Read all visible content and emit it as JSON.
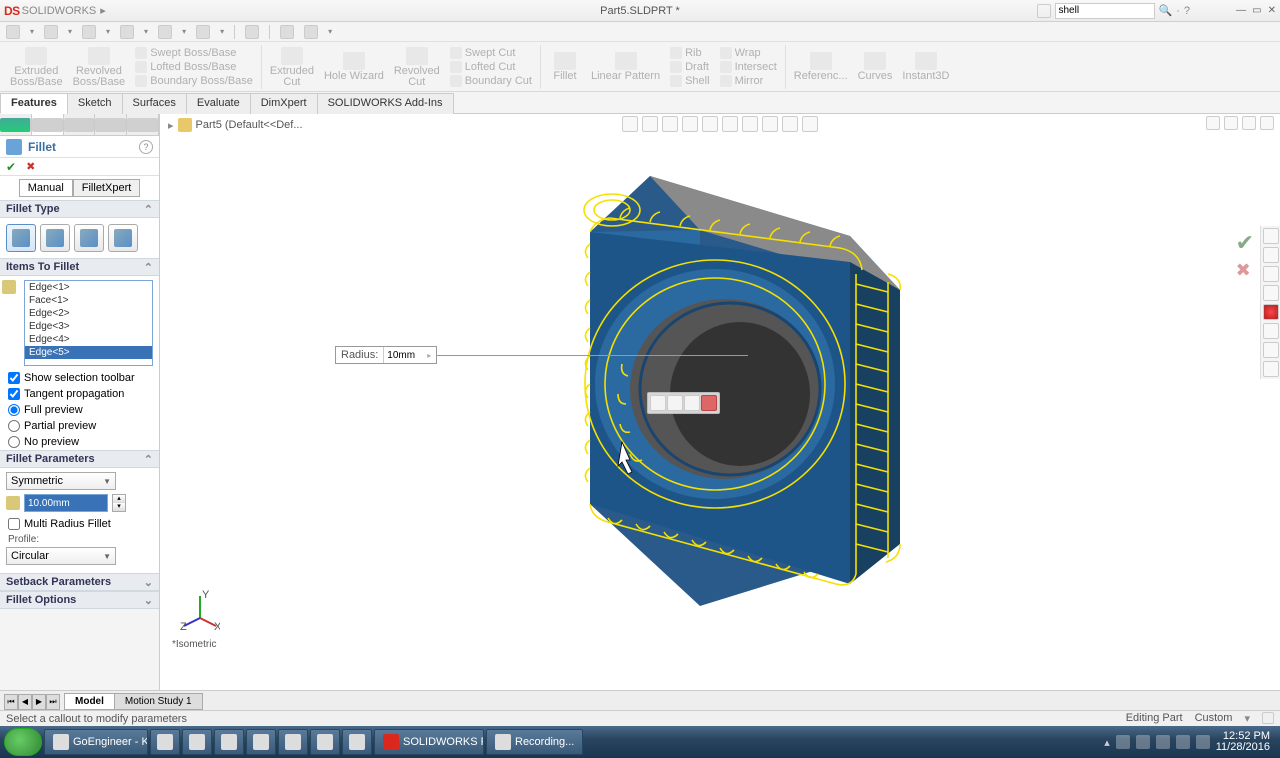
{
  "app": {
    "brand": "SOLIDWORKS",
    "doc_title": "Part5.SLDPRT *",
    "search_placeholder": "shell"
  },
  "ribbon_tabs": [
    "Features",
    "Sketch",
    "Surfaces",
    "Evaluate",
    "DimXpert",
    "SOLIDWORKS Add-Ins"
  ],
  "ribbon": {
    "g1": {
      "a": "Extruded",
      "b": "Boss/Base"
    },
    "g2": {
      "a": "Revolved",
      "b": "Boss/Base"
    },
    "l1": [
      "Swept Boss/Base",
      "Lofted Boss/Base",
      "Boundary Boss/Base"
    ],
    "g3": {
      "a": "Extruded",
      "b": "Cut"
    },
    "g4": {
      "a": "Hole Wizard",
      "b": ""
    },
    "g5": {
      "a": "Revolved",
      "b": "Cut"
    },
    "l2": [
      "Swept Cut",
      "Lofted Cut",
      "Boundary Cut"
    ],
    "g6": {
      "a": "Fillet",
      "b": ""
    },
    "g7": {
      "a": "Linear Pattern",
      "b": ""
    },
    "l3": [
      "Rib",
      "Draft",
      "Shell"
    ],
    "l4": [
      "Wrap",
      "Intersect",
      "Mirror"
    ],
    "g8": {
      "a": "Referenc...",
      "b": ""
    },
    "g9": {
      "a": "Curves",
      "b": ""
    },
    "g10": {
      "a": "Instant3D",
      "b": ""
    }
  },
  "breadcrumb": "Part5  (Default<<Def...",
  "pm": {
    "title": "Fillet",
    "mode": {
      "manual": "Manual",
      "expert": "FilletXpert"
    },
    "sec_type": "Fillet Type",
    "sec_items": "Items To Fillet",
    "items": [
      "Edge<1>",
      "Face<1>",
      "Edge<2>",
      "Edge<3>",
      "Edge<4>",
      "Edge<5>"
    ],
    "chk_toolbar": "Show selection toolbar",
    "chk_tangent": "Tangent propagation",
    "r_full": "Full preview",
    "r_partial": "Partial preview",
    "r_none": "No preview",
    "sec_params": "Fillet Parameters",
    "symmetric": "Symmetric",
    "radius_val": "10.00mm",
    "multi": "Multi Radius Fillet",
    "profile_lbl": "Profile:",
    "profile": "Circular",
    "sec_setback": "Setback Parameters",
    "sec_options": "Fillet Options"
  },
  "callout": {
    "label": "Radius:",
    "value": "10mm"
  },
  "orientation": "*Isometric",
  "bottom_tabs": {
    "model": "Model",
    "motion": "Motion Study 1"
  },
  "status": {
    "msg": "Select a callout to modify parameters",
    "mode": "Editing Part",
    "custom": "Custom"
  },
  "taskbar": {
    "items": [
      "GoEngineer - K...",
      "",
      "",
      "",
      "",
      "",
      "",
      "",
      "SOLIDWORKS P...",
      "Recording..."
    ],
    "time": "12:52 PM",
    "date": "11/28/2016"
  }
}
